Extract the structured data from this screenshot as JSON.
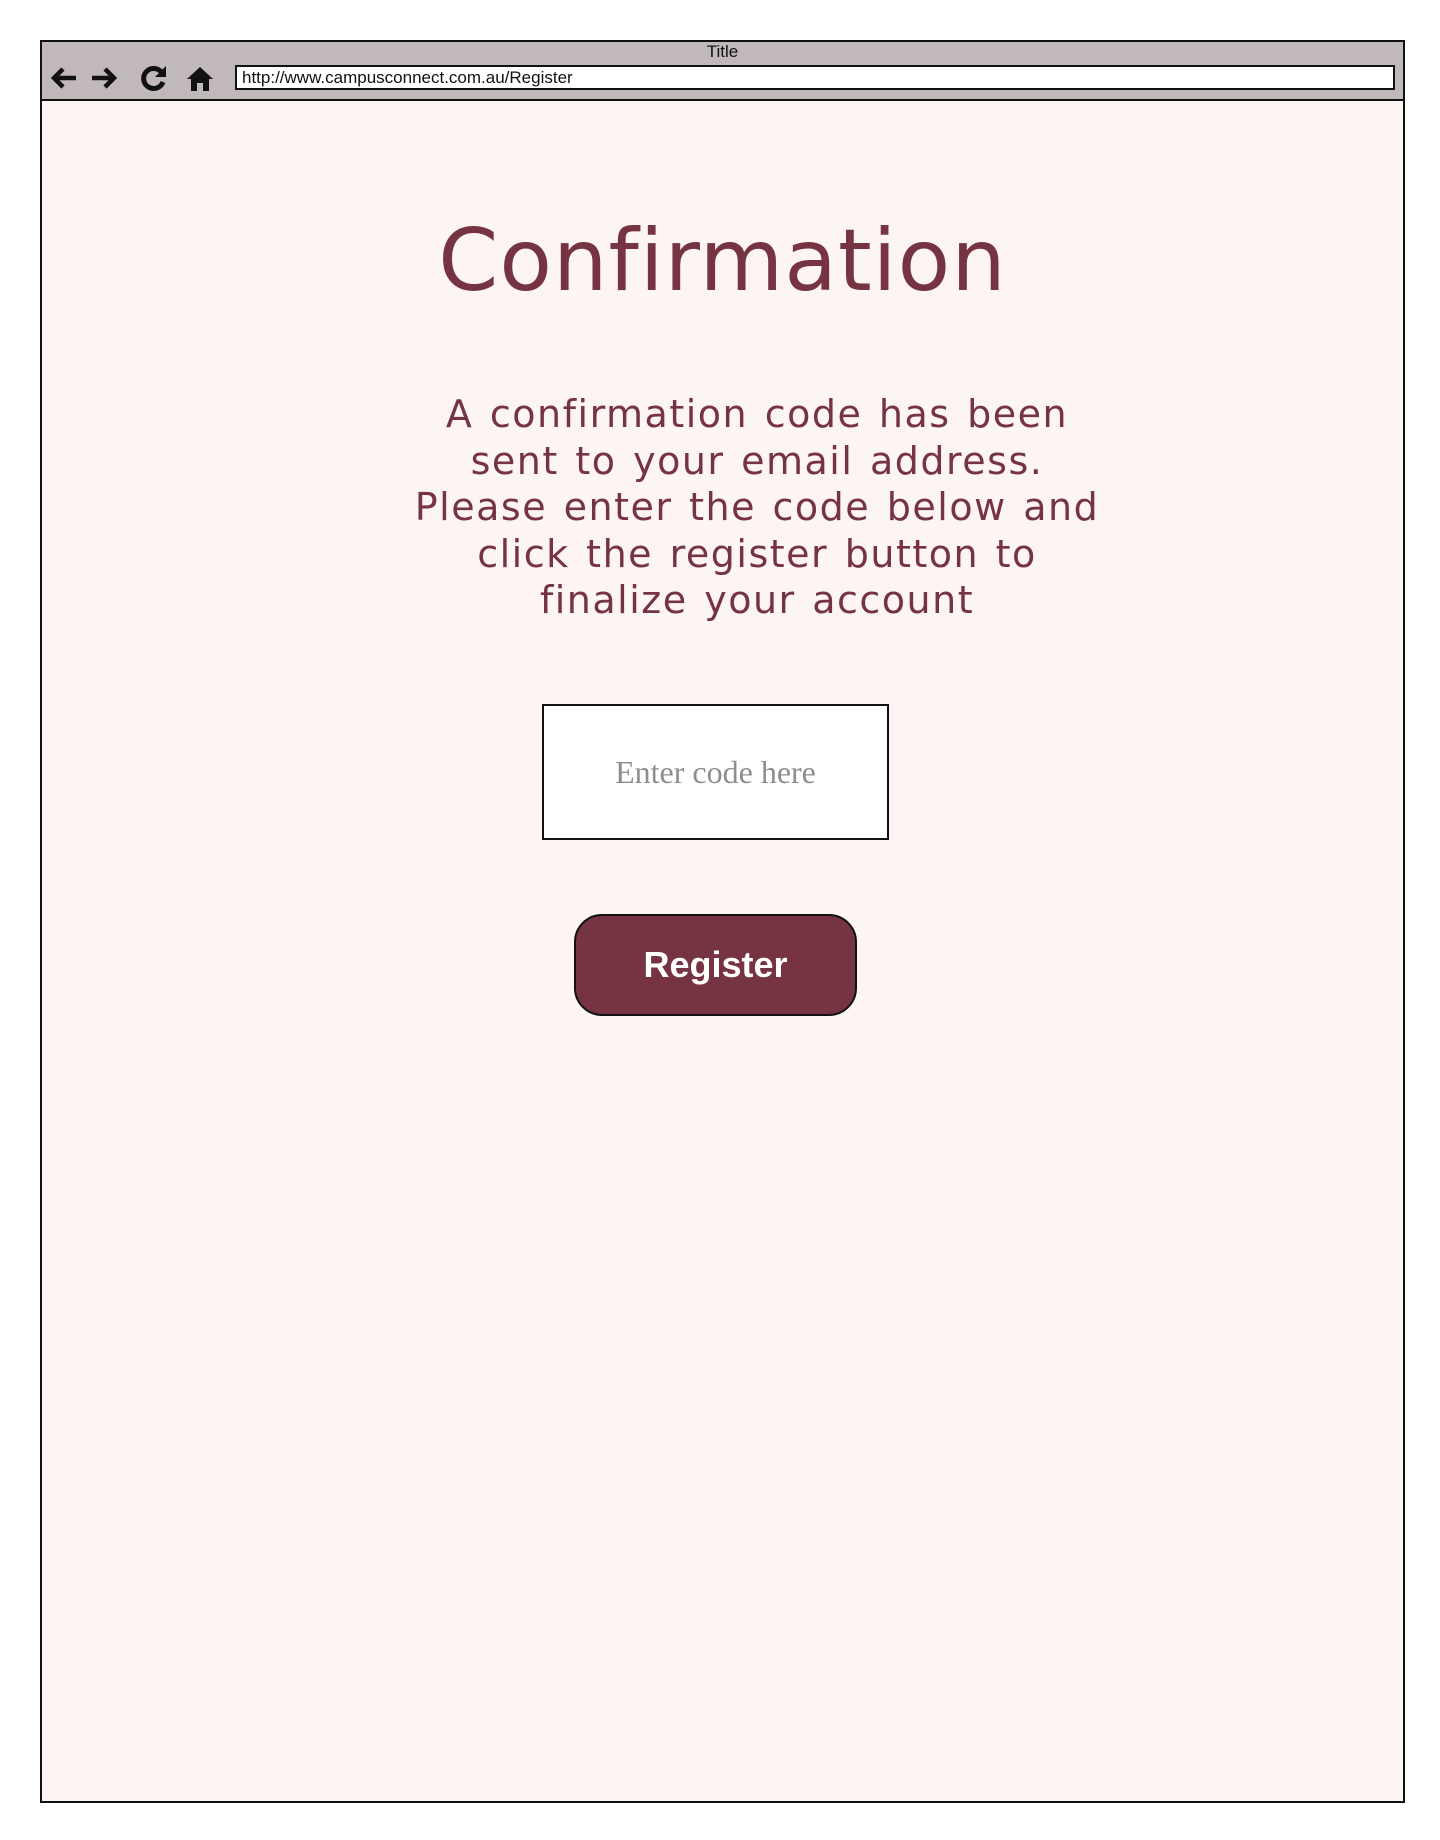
{
  "browser": {
    "window_title": "Title",
    "url": "http://www.campusconnect.com.au/Register",
    "nav_icons": [
      "back-arrow-icon",
      "forward-arrow-icon",
      "refresh-icon",
      "home-icon"
    ]
  },
  "page": {
    "title": "Confirmation",
    "instructions": "A confirmation code has been sent to your email address. Please enter the code below and click the register button to finalize your account",
    "code_input": {
      "value": "",
      "placeholder": "Enter code here"
    },
    "register_label": "Register"
  },
  "colors": {
    "accent": "#763442",
    "page_background": "#fdf5f4",
    "toolbar_background": "#c0b8b9"
  }
}
